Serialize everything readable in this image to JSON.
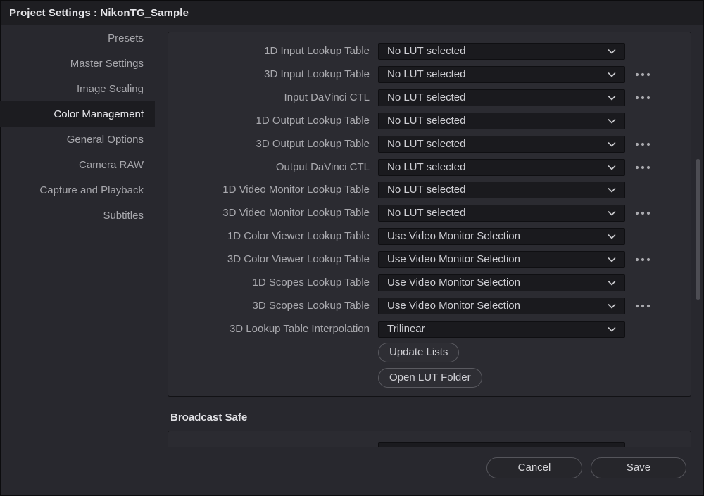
{
  "window": {
    "title": "Project Settings : NikonTG_Sample"
  },
  "sidebar": {
    "items": [
      {
        "label": "Presets",
        "active": false
      },
      {
        "label": "Master Settings",
        "active": false
      },
      {
        "label": "Image Scaling",
        "active": false
      },
      {
        "label": "Color Management",
        "active": true
      },
      {
        "label": "General Options",
        "active": false
      },
      {
        "label": "Camera RAW",
        "active": false
      },
      {
        "label": "Capture and Playback",
        "active": false
      },
      {
        "label": "Subtitles",
        "active": false
      }
    ]
  },
  "lut": {
    "rows": [
      {
        "label": "1D Input Lookup Table",
        "value": "No LUT selected",
        "more": false
      },
      {
        "label": "3D Input Lookup Table",
        "value": "No LUT selected",
        "more": true
      },
      {
        "label": "Input DaVinci CTL",
        "value": "No LUT selected",
        "more": true
      },
      {
        "label": "1D Output Lookup Table",
        "value": "No LUT selected",
        "more": false
      },
      {
        "label": "3D Output Lookup Table",
        "value": "No LUT selected",
        "more": true
      },
      {
        "label": "Output DaVinci CTL",
        "value": "No LUT selected",
        "more": true
      },
      {
        "label": "1D Video Monitor Lookup Table",
        "value": "No LUT selected",
        "more": false
      },
      {
        "label": "3D Video Monitor Lookup Table",
        "value": "No LUT selected",
        "more": true
      },
      {
        "label": "1D Color Viewer Lookup Table",
        "value": "Use Video Monitor Selection",
        "more": false
      },
      {
        "label": "3D Color Viewer Lookup Table",
        "value": "Use Video Monitor Selection",
        "more": true
      },
      {
        "label": "1D Scopes Lookup Table",
        "value": "Use Video Monitor Selection",
        "more": false
      },
      {
        "label": "3D Scopes Lookup Table",
        "value": "Use Video Monitor Selection",
        "more": true
      },
      {
        "label": "3D Lookup Table Interpolation",
        "value": "Trilinear",
        "more": false
      }
    ],
    "update_lists_label": "Update Lists",
    "open_folder_label": "Open LUT Folder"
  },
  "broadcast_safe": {
    "title": "Broadcast Safe"
  },
  "footer": {
    "cancel_label": "Cancel",
    "save_label": "Save"
  },
  "icons": {
    "dropdown": "chevron-down-icon",
    "more": "more-horizontal-icon"
  },
  "colors": {
    "background": "#28282e",
    "panel": "#2b2b31",
    "field": "#1a1a1e",
    "active_nav": "#1c1c20"
  }
}
